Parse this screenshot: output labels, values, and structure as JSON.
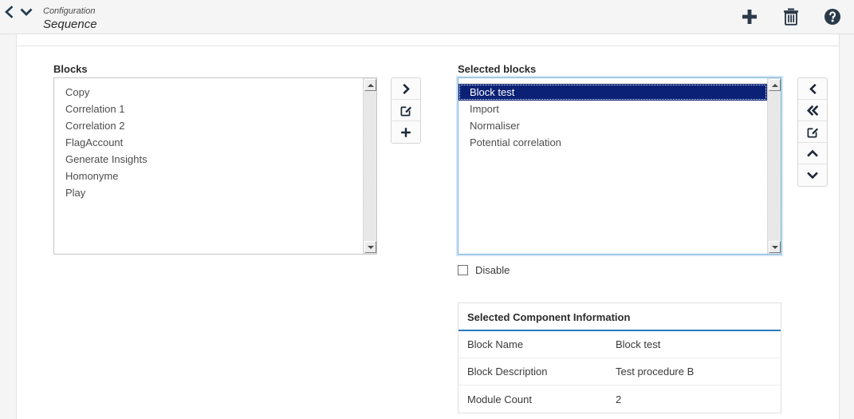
{
  "header": {
    "breadcrumb_parent": "Configuration",
    "page_title": "Sequence",
    "nav": {
      "back_label": "Back",
      "dropdown_label": "Expand"
    },
    "actions": [
      {
        "name": "add",
        "label": "Add",
        "icon": "plus-icon"
      },
      {
        "name": "delete",
        "label": "Delete",
        "icon": "trash-icon"
      },
      {
        "name": "help",
        "label": "Help",
        "icon": "help-circle-icon"
      }
    ]
  },
  "blocks_panel": {
    "label": "Blocks",
    "items": [
      "Copy",
      "Correlation 1",
      "Correlation 2",
      "FlagAccount",
      "Generate Insights",
      "Homonyme",
      "Play"
    ]
  },
  "middle_buttons": [
    {
      "name": "move-right",
      "label": "Move right",
      "icon": "chevron-right-icon"
    },
    {
      "name": "edit-block",
      "label": "Edit",
      "icon": "edit-square-icon"
    },
    {
      "name": "add-block",
      "label": "Add",
      "icon": "plus-icon"
    }
  ],
  "selected_panel": {
    "label": "Selected blocks",
    "items": [
      "Block test",
      "Import",
      "Normaliser",
      "Potential correlation"
    ],
    "selected_index": 0
  },
  "right_buttons": [
    {
      "name": "move-left",
      "label": "Move left",
      "icon": "chevron-left-icon"
    },
    {
      "name": "move-all-left",
      "label": "Move all left",
      "icon": "chevron-double-left-icon"
    },
    {
      "name": "edit-selected",
      "label": "Edit",
      "icon": "edit-square-icon"
    },
    {
      "name": "move-up",
      "label": "Move up",
      "icon": "chevron-up-icon"
    },
    {
      "name": "move-down",
      "label": "Move down",
      "icon": "chevron-down-icon"
    }
  ],
  "disable_checkbox": {
    "label": "Disable",
    "checked": false
  },
  "info_table": {
    "title": "Selected Component Information",
    "rows": [
      {
        "key": "Block Name",
        "value": "Block test"
      },
      {
        "key": "Block Description",
        "value": "Test procedure B"
      },
      {
        "key": "Module Count",
        "value": "2"
      }
    ]
  },
  "colors": {
    "header_bg": "#f5f5f5",
    "selection_bg": "#0b2175",
    "accent_underline": "#2a7ab9",
    "icon_dark": "#2b3a4a",
    "focus_ring": "#7eb4d8"
  }
}
